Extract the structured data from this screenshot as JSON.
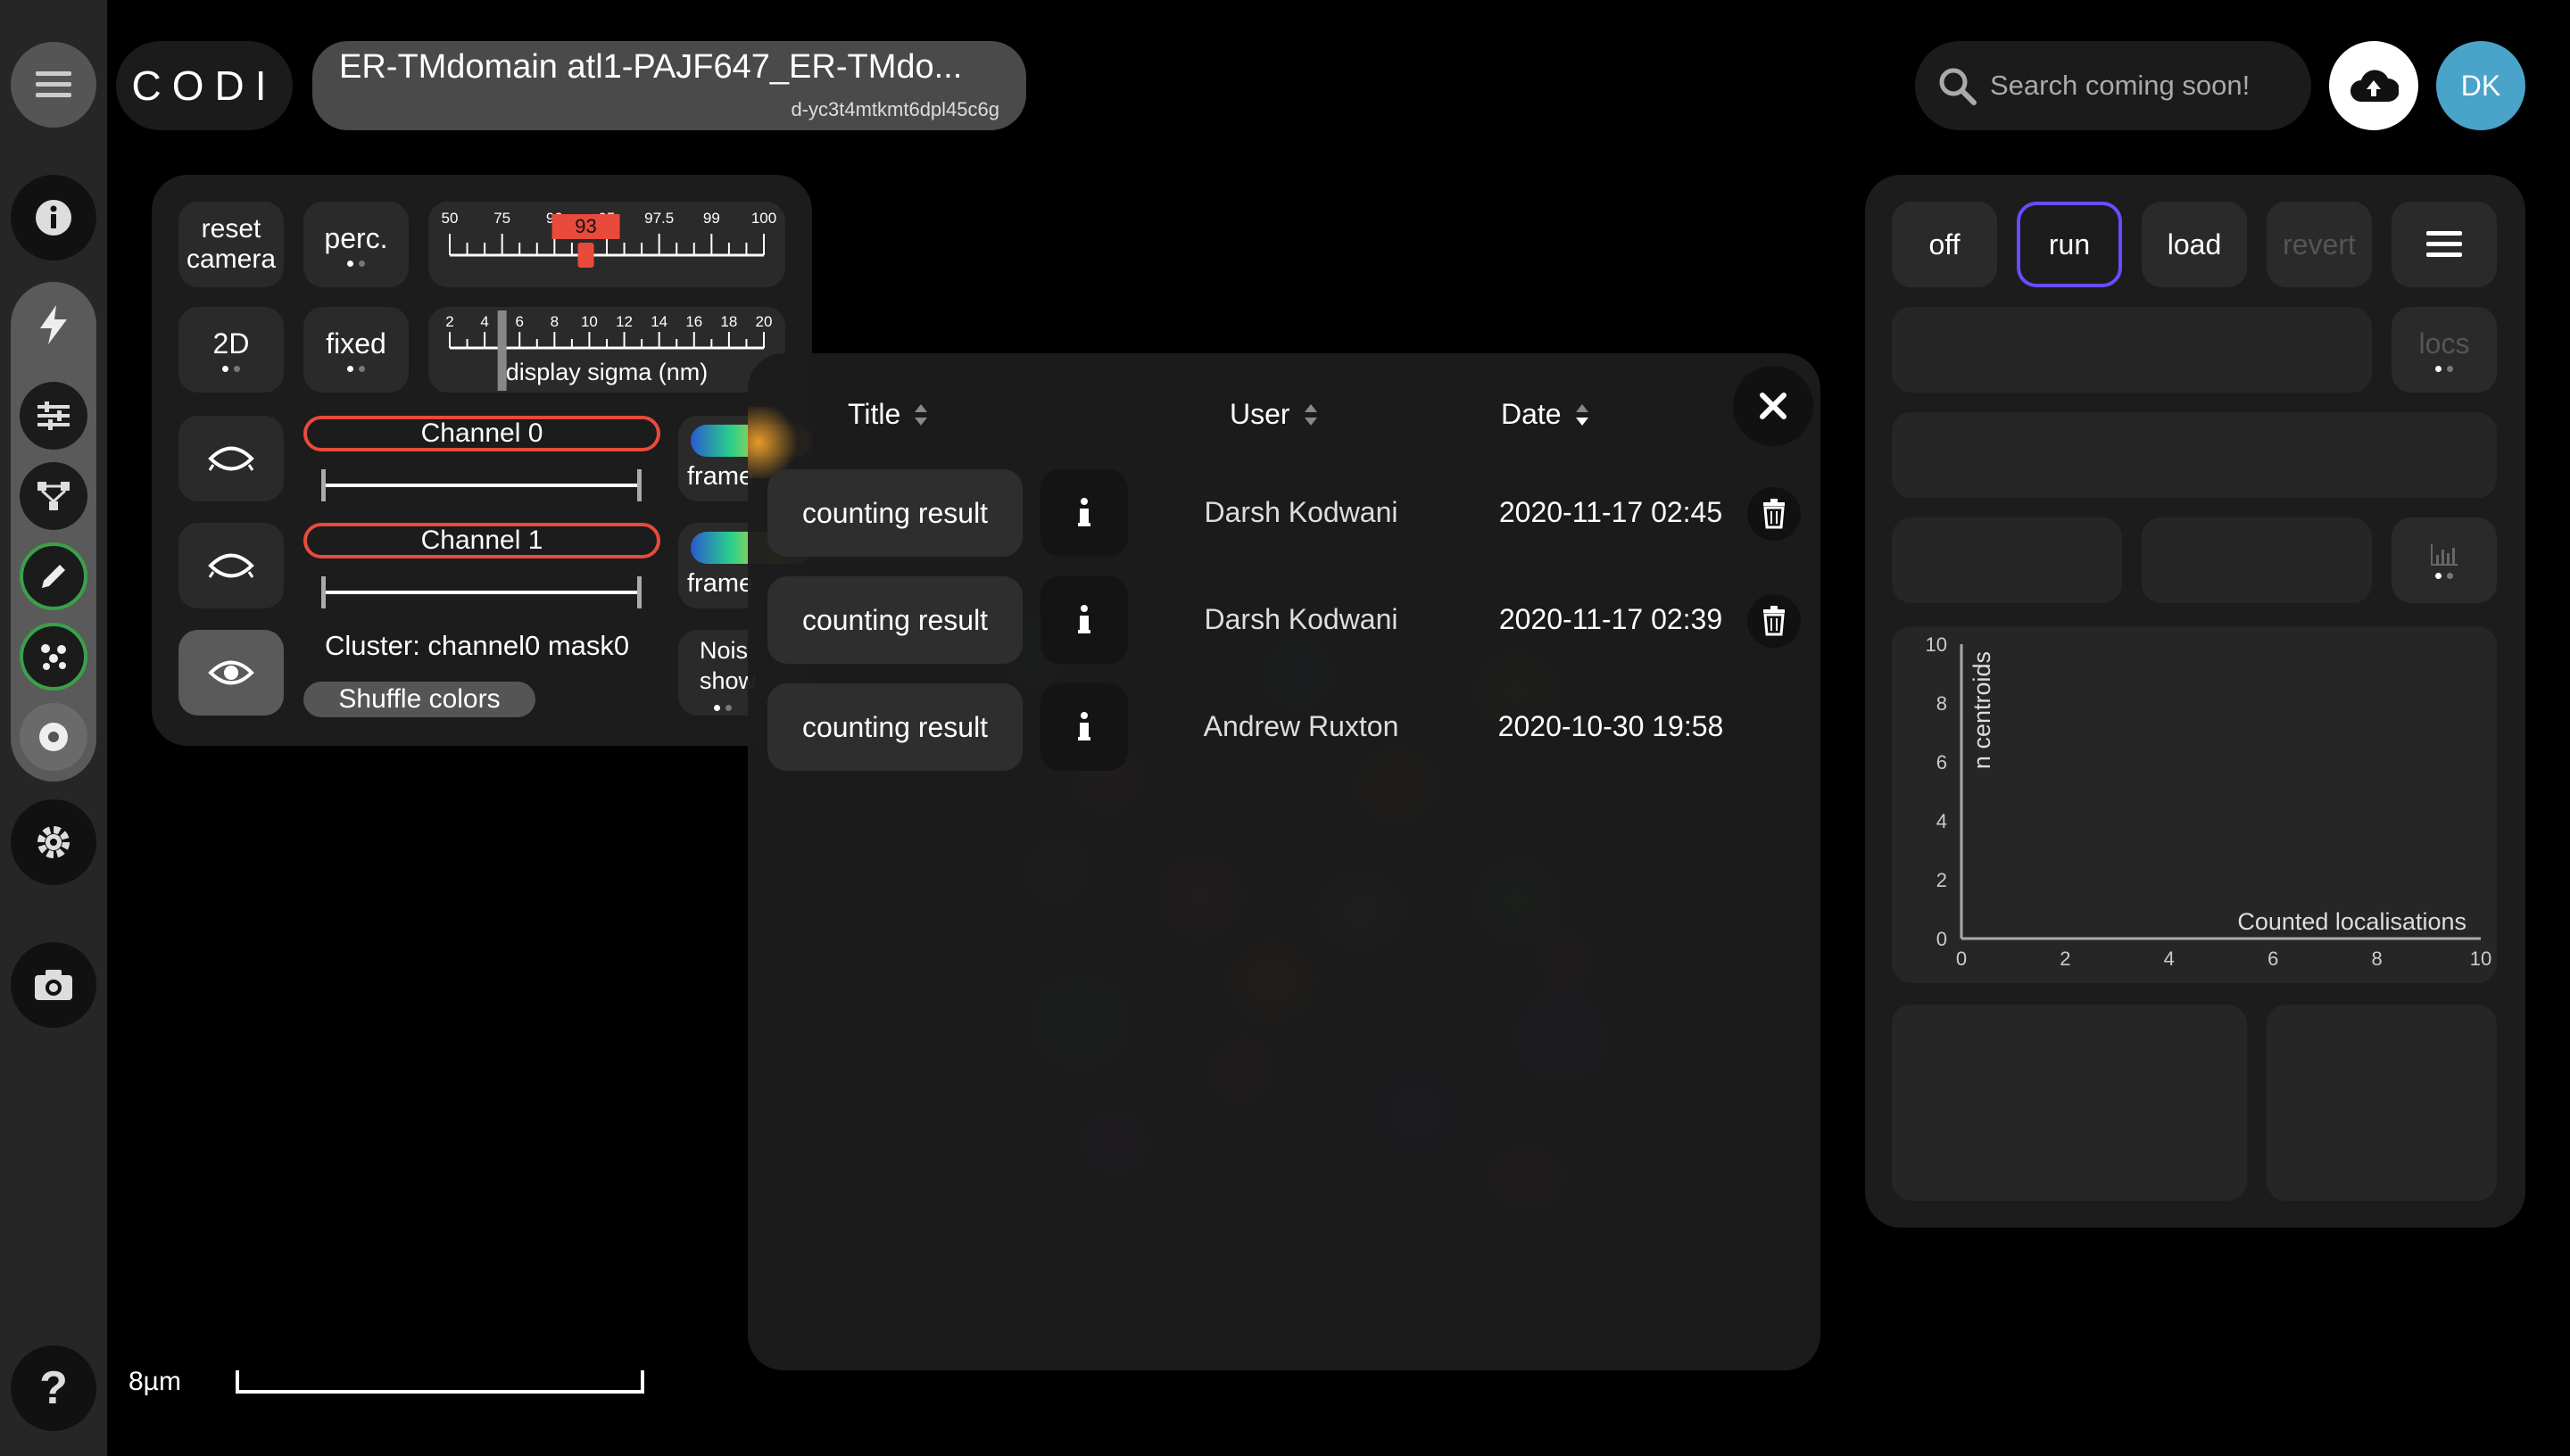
{
  "app": {
    "logo": "CODI",
    "title": "ER-TMdomain atl1-PAJF647_ER-TMdo...",
    "subtitle": "d-yc3t4mtkmt6dpl45c6g",
    "search_placeholder": "Search coming soon!",
    "avatar_initials": "DK"
  },
  "controls": {
    "reset_camera": [
      "reset",
      "camera"
    ],
    "perc": "perc.",
    "mode_2d": "2D",
    "fixed": "fixed",
    "percentile_ticks": [
      "50",
      "75",
      "90",
      "95",
      "97.5",
      "99",
      "100"
    ],
    "percentile_value": "93",
    "sigma_ticks": [
      "2",
      "4",
      "6",
      "8",
      "10",
      "12",
      "14",
      "16",
      "18",
      "20"
    ],
    "sigma_label": "display sigma (nm)",
    "channel0": "Channel 0",
    "channel1": "Channel 1",
    "frame_label": "frame",
    "cluster_label": "Cluster: channel0 mask0",
    "shuffle_colors": "Shuffle colors",
    "noise_label": [
      "Nois",
      "show"
    ]
  },
  "results_modal": {
    "columns": {
      "title": "Title",
      "user": "User",
      "date": "Date"
    },
    "rows": [
      {
        "title": "counting result",
        "user": "Darsh Kodwani",
        "date": "2020-11-17 02:45"
      },
      {
        "title": "counting result",
        "user": "Darsh Kodwani",
        "date": "2020-11-17 02:39"
      },
      {
        "title": "counting result",
        "user": "Andrew Ruxton",
        "date": "2020-10-30 19:58"
      }
    ]
  },
  "right_panel": {
    "off": "off",
    "run": "run",
    "load": "load",
    "revert": "revert",
    "locs": "locs"
  },
  "chart_data": {
    "type": "bar",
    "title": "",
    "xlabel": "Counted localisations",
    "ylabel": "n centroids",
    "xlim": [
      0,
      10
    ],
    "ylim": [
      0,
      10
    ],
    "x_ticks": [
      "0",
      "2",
      "4",
      "6",
      "8",
      "10"
    ],
    "y_ticks": [
      "0",
      "2",
      "4",
      "6",
      "8",
      "10"
    ],
    "values": []
  },
  "scale_bar": {
    "label": "8µm"
  },
  "colors": {
    "accent_run": "#6a4cff",
    "channel_border": "#e84a3c",
    "avatar": "#4aa3c9",
    "active_rail": "#3aa04a",
    "percentile_marker": "#e84a3c"
  }
}
